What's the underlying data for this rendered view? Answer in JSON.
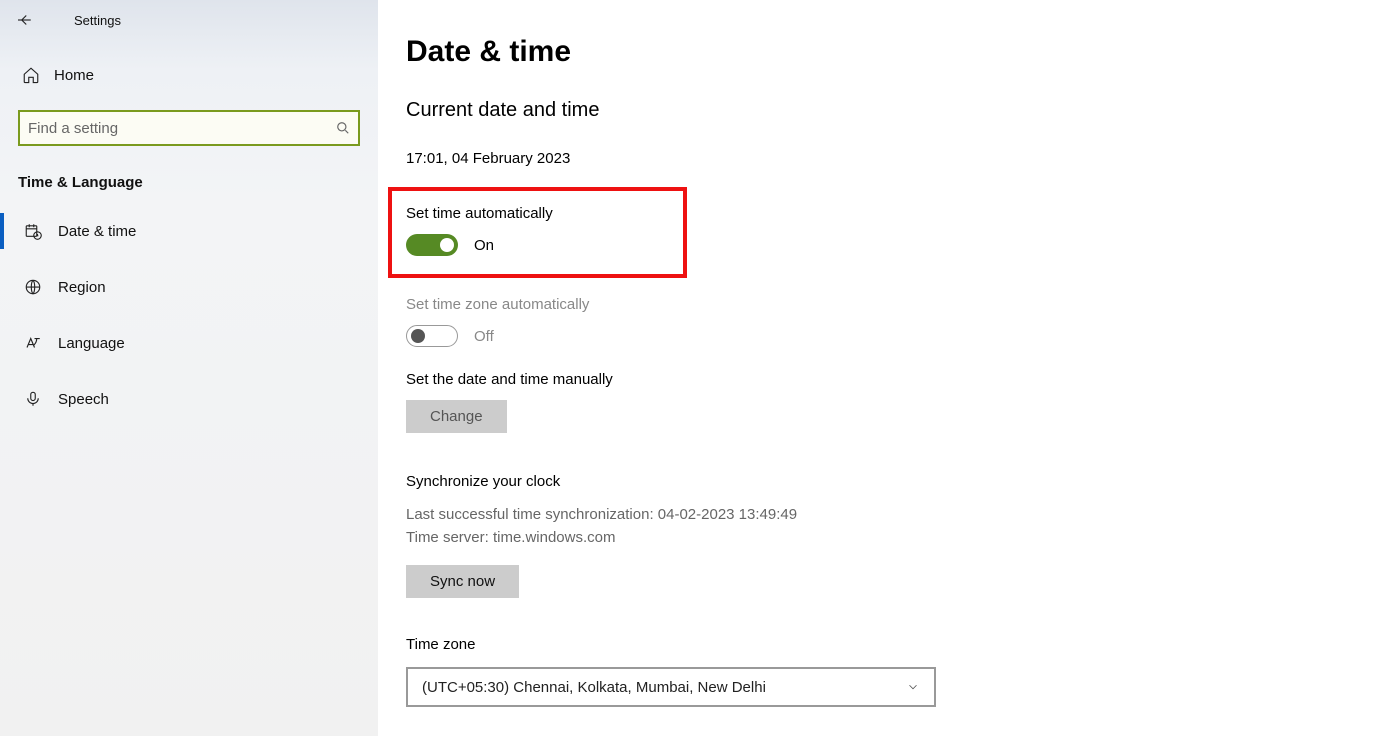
{
  "app": {
    "title": "Settings"
  },
  "sidebar": {
    "home_label": "Home",
    "search_placeholder": "Find a setting",
    "category": "Time & Language",
    "items": [
      {
        "label": "Date & time"
      },
      {
        "label": "Region"
      },
      {
        "label": "Language"
      },
      {
        "label": "Speech"
      }
    ]
  },
  "main": {
    "title": "Date & time",
    "current_section": "Current date and time",
    "current_value": "17:01, 04 February 2023",
    "auto_time": {
      "label": "Set time automatically",
      "state": "On"
    },
    "auto_tz": {
      "label": "Set time zone automatically",
      "state": "Off"
    },
    "manual": {
      "label": "Set the date and time manually",
      "button": "Change"
    },
    "sync": {
      "title": "Synchronize your clock",
      "last": "Last successful time synchronization: 04-02-2023 13:49:49",
      "server": "Time server: time.windows.com",
      "button": "Sync now"
    },
    "tz": {
      "label": "Time zone",
      "value": "(UTC+05:30) Chennai, Kolkata, Mumbai, New Delhi"
    }
  }
}
